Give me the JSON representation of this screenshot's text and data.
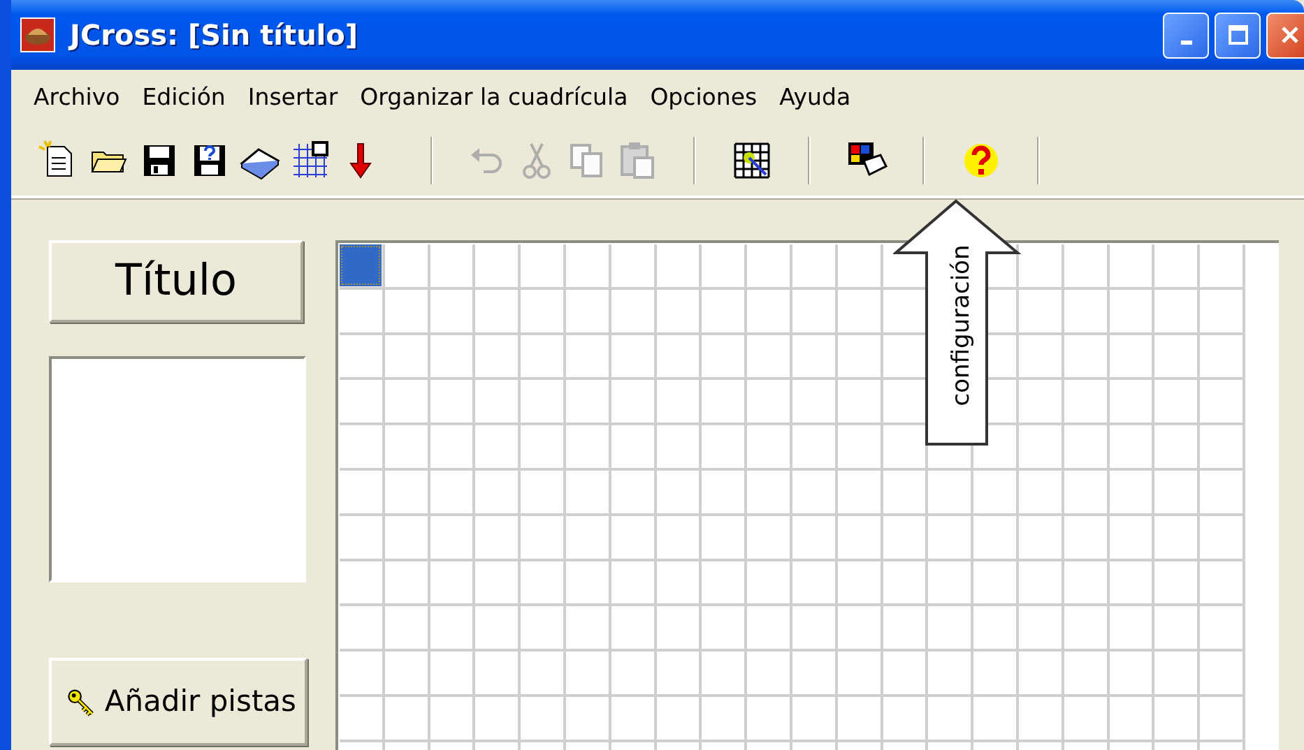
{
  "window": {
    "title": "JCross: [Sin título]"
  },
  "menu": [
    "Archivo",
    "Edición",
    "Insertar",
    "Organizar la cuadrícula",
    "Opciones",
    "Ayuda"
  ],
  "toolbar": [
    {
      "kind": "new",
      "disabled": false
    },
    {
      "kind": "open",
      "disabled": false
    },
    {
      "kind": "save",
      "disabled": false
    },
    {
      "kind": "save-help",
      "disabled": false
    },
    {
      "kind": "book",
      "disabled": false
    },
    {
      "kind": "numbered-grid",
      "disabled": false
    },
    {
      "kind": "arrow",
      "disabled": false
    },
    {
      "kind": "separator"
    },
    {
      "kind": "undo",
      "disabled": true
    },
    {
      "kind": "cut",
      "disabled": true
    },
    {
      "kind": "copy",
      "disabled": true
    },
    {
      "kind": "paste",
      "disabled": true
    },
    {
      "kind": "separator"
    },
    {
      "kind": "grid",
      "disabled": false
    },
    {
      "kind": "separator"
    },
    {
      "kind": "config",
      "disabled": false
    },
    {
      "kind": "separator"
    },
    {
      "kind": "help",
      "disabled": false
    },
    {
      "kind": "separator"
    }
  ],
  "title_button": "Título",
  "clues_button": "Añadir pistas",
  "callout": "configuración",
  "grid": {
    "cursor_visible": true
  }
}
